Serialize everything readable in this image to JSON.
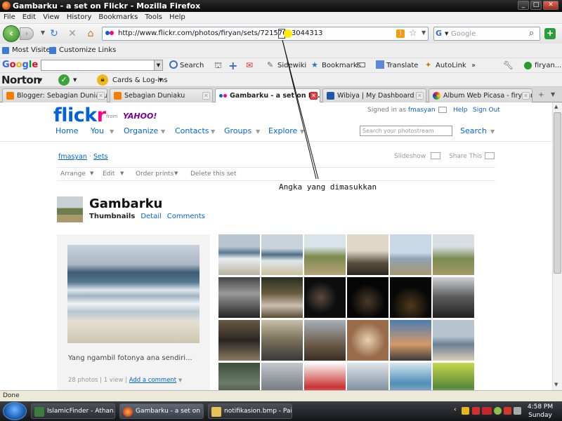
{
  "window": {
    "title": "Gambarku - a set on Flickr - Mozilla Firefox"
  },
  "menu": [
    "File",
    "Edit",
    "View",
    "History",
    "Bookmarks",
    "Tools",
    "Help"
  ],
  "nav": {
    "url": "http://www.flickr.com/photos/firyan/sets/72157613044313",
    "search_placeholder": "Google"
  },
  "bookmarks": [
    "Most Visited",
    "Customize Links"
  ],
  "google_toolbar": {
    "logo": "Google",
    "search_label": "Search",
    "items": [
      "Sidewiki",
      "Bookmarks",
      "Translate",
      "AutoLink",
      "firyan..."
    ]
  },
  "norton": {
    "logo": "Norton",
    "cards_label": "Cards & Log-ins"
  },
  "tabs": [
    {
      "label": "Blogger: Sebagian Duniaku ...",
      "color": "#f57d00"
    },
    {
      "label": "Sebagian Duniaku",
      "color": "#f57d00"
    },
    {
      "label": "Gambarku - a set on Fli...",
      "color": "#0063dc",
      "active": true
    },
    {
      "label": "Wibiya | My Dashboard",
      "color": "#2255aa"
    },
    {
      "label": "Album Web Picasa - firyanr...",
      "color": "#c33"
    }
  ],
  "flickr": {
    "logo": "flickr",
    "from": "from",
    "yahoo": "YAHOO!",
    "signed_in_prefix": "Signed in as",
    "username": "fmasyan",
    "help": "Help",
    "sign_out": "Sign Out",
    "nav": [
      "Home",
      "You",
      "Organize",
      "Contacts",
      "Groups",
      "Explore"
    ],
    "search_placeholder": "Search your photostream",
    "search_button": "Search",
    "crumb_user": "fmasyan",
    "crumb_sets": "Sets",
    "slideshow": "Slideshow",
    "share": "Share This",
    "set_actions": [
      "Arrange",
      "Edit",
      "Order prints",
      "Delete this set"
    ],
    "set_title": "Gambarku",
    "set_tabs": [
      "Thumbnails",
      "Detail",
      "Comments"
    ],
    "caption": "Yang ngambil fotonya ana sendiri...",
    "counts": "28 photos | 1 view |",
    "add_comment": "Add a comment"
  },
  "annotation": "Angka yang dimasukkan",
  "status": "Done",
  "taskbar": {
    "items": [
      "IslamicFinder - Athan...",
      "Gambarku - a set on ...",
      "notifikasion.bmp - Paint"
    ],
    "time": "4:58 PM",
    "day": "Sunday"
  }
}
